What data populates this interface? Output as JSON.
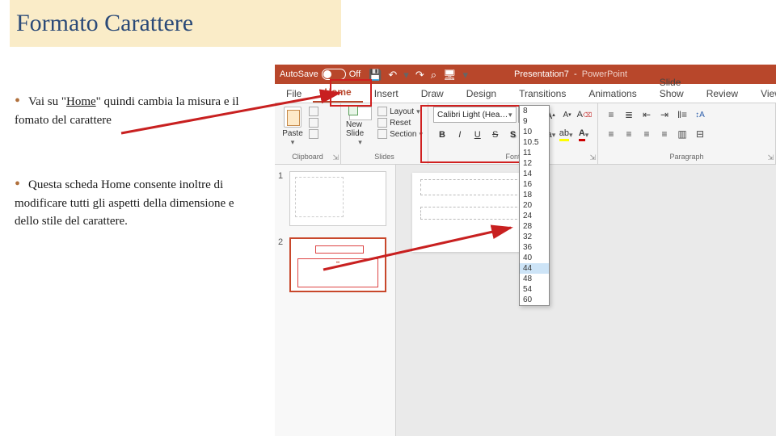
{
  "slide": {
    "title": "Formato Carattere",
    "bullet1_pre": "Vai su \"",
    "bullet1_home": "Home",
    "bullet1_post": "\" quindi cambia la misura e il fomato del carattere",
    "bullet2": "Questa scheda Home consente inoltre di modificare tutti gli aspetti della dimensione e dello stile del carattere."
  },
  "titlebar": {
    "autosave": "AutoSave",
    "off": "Off",
    "title": "Presentation7",
    "app": "PowerPoint"
  },
  "qat": {
    "save": "💾",
    "undo": "↶",
    "redo": "↷",
    "present": "⌕",
    "touch": "🖥",
    "more": "▾"
  },
  "tabs": {
    "file": "File",
    "home": "Home",
    "insert": "Insert",
    "draw": "Draw",
    "design": "Design",
    "transitions": "Transitions",
    "animations": "Animations",
    "slideshow": "Slide Show",
    "review": "Review",
    "view": "View"
  },
  "ribbon": {
    "clipboard": {
      "paste": "Paste",
      "cut": "Cut",
      "copy": "Copy",
      "fmt": "Format",
      "label": "Clipboard"
    },
    "slides": {
      "new": "New Slide",
      "layout": "Layout",
      "reset": "Reset",
      "section": "Section",
      "label": "Slides"
    },
    "font": {
      "name": "Calibri Light (Headings)",
      "size": "44",
      "grow": "A▴",
      "shrink": "A▾",
      "clear": "A⌫",
      "b": "B",
      "i": "I",
      "u": "U",
      "s": "S",
      "shadow": "S",
      "spacing": "AV",
      "highlight": "ab",
      "color": "A",
      "label": "Font"
    },
    "para": {
      "label": "Paragraph"
    }
  },
  "sizes": [
    "8",
    "9",
    "10",
    "10.5",
    "11",
    "12",
    "14",
    "16",
    "18",
    "20",
    "24",
    "28",
    "32",
    "36",
    "40",
    "44",
    "48",
    "54",
    "60"
  ],
  "size_selected": "44",
  "thumbs": {
    "n1": "1",
    "n2": "2",
    "thumb2_label": "••"
  }
}
